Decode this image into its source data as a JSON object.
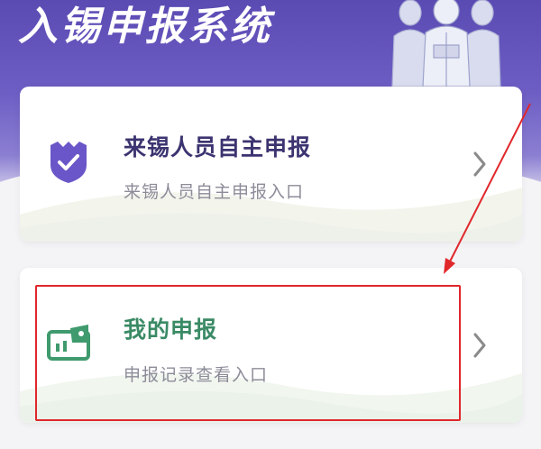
{
  "header": {
    "title": "入锡申报系统",
    "accent_color": "#5a4bb3"
  },
  "cards": [
    {
      "title": "来锡人员自主申报",
      "subtitle": "来锡人员自主申报入口",
      "icon": "shield-check-icon",
      "title_color": "#3b3470"
    },
    {
      "title": "我的申报",
      "subtitle": "申报记录查看入口",
      "icon": "id-card-icon",
      "title_color": "#3a8a65"
    }
  ],
  "annotation": {
    "color": "#e0272b",
    "highlighted_item": "我的申报"
  }
}
